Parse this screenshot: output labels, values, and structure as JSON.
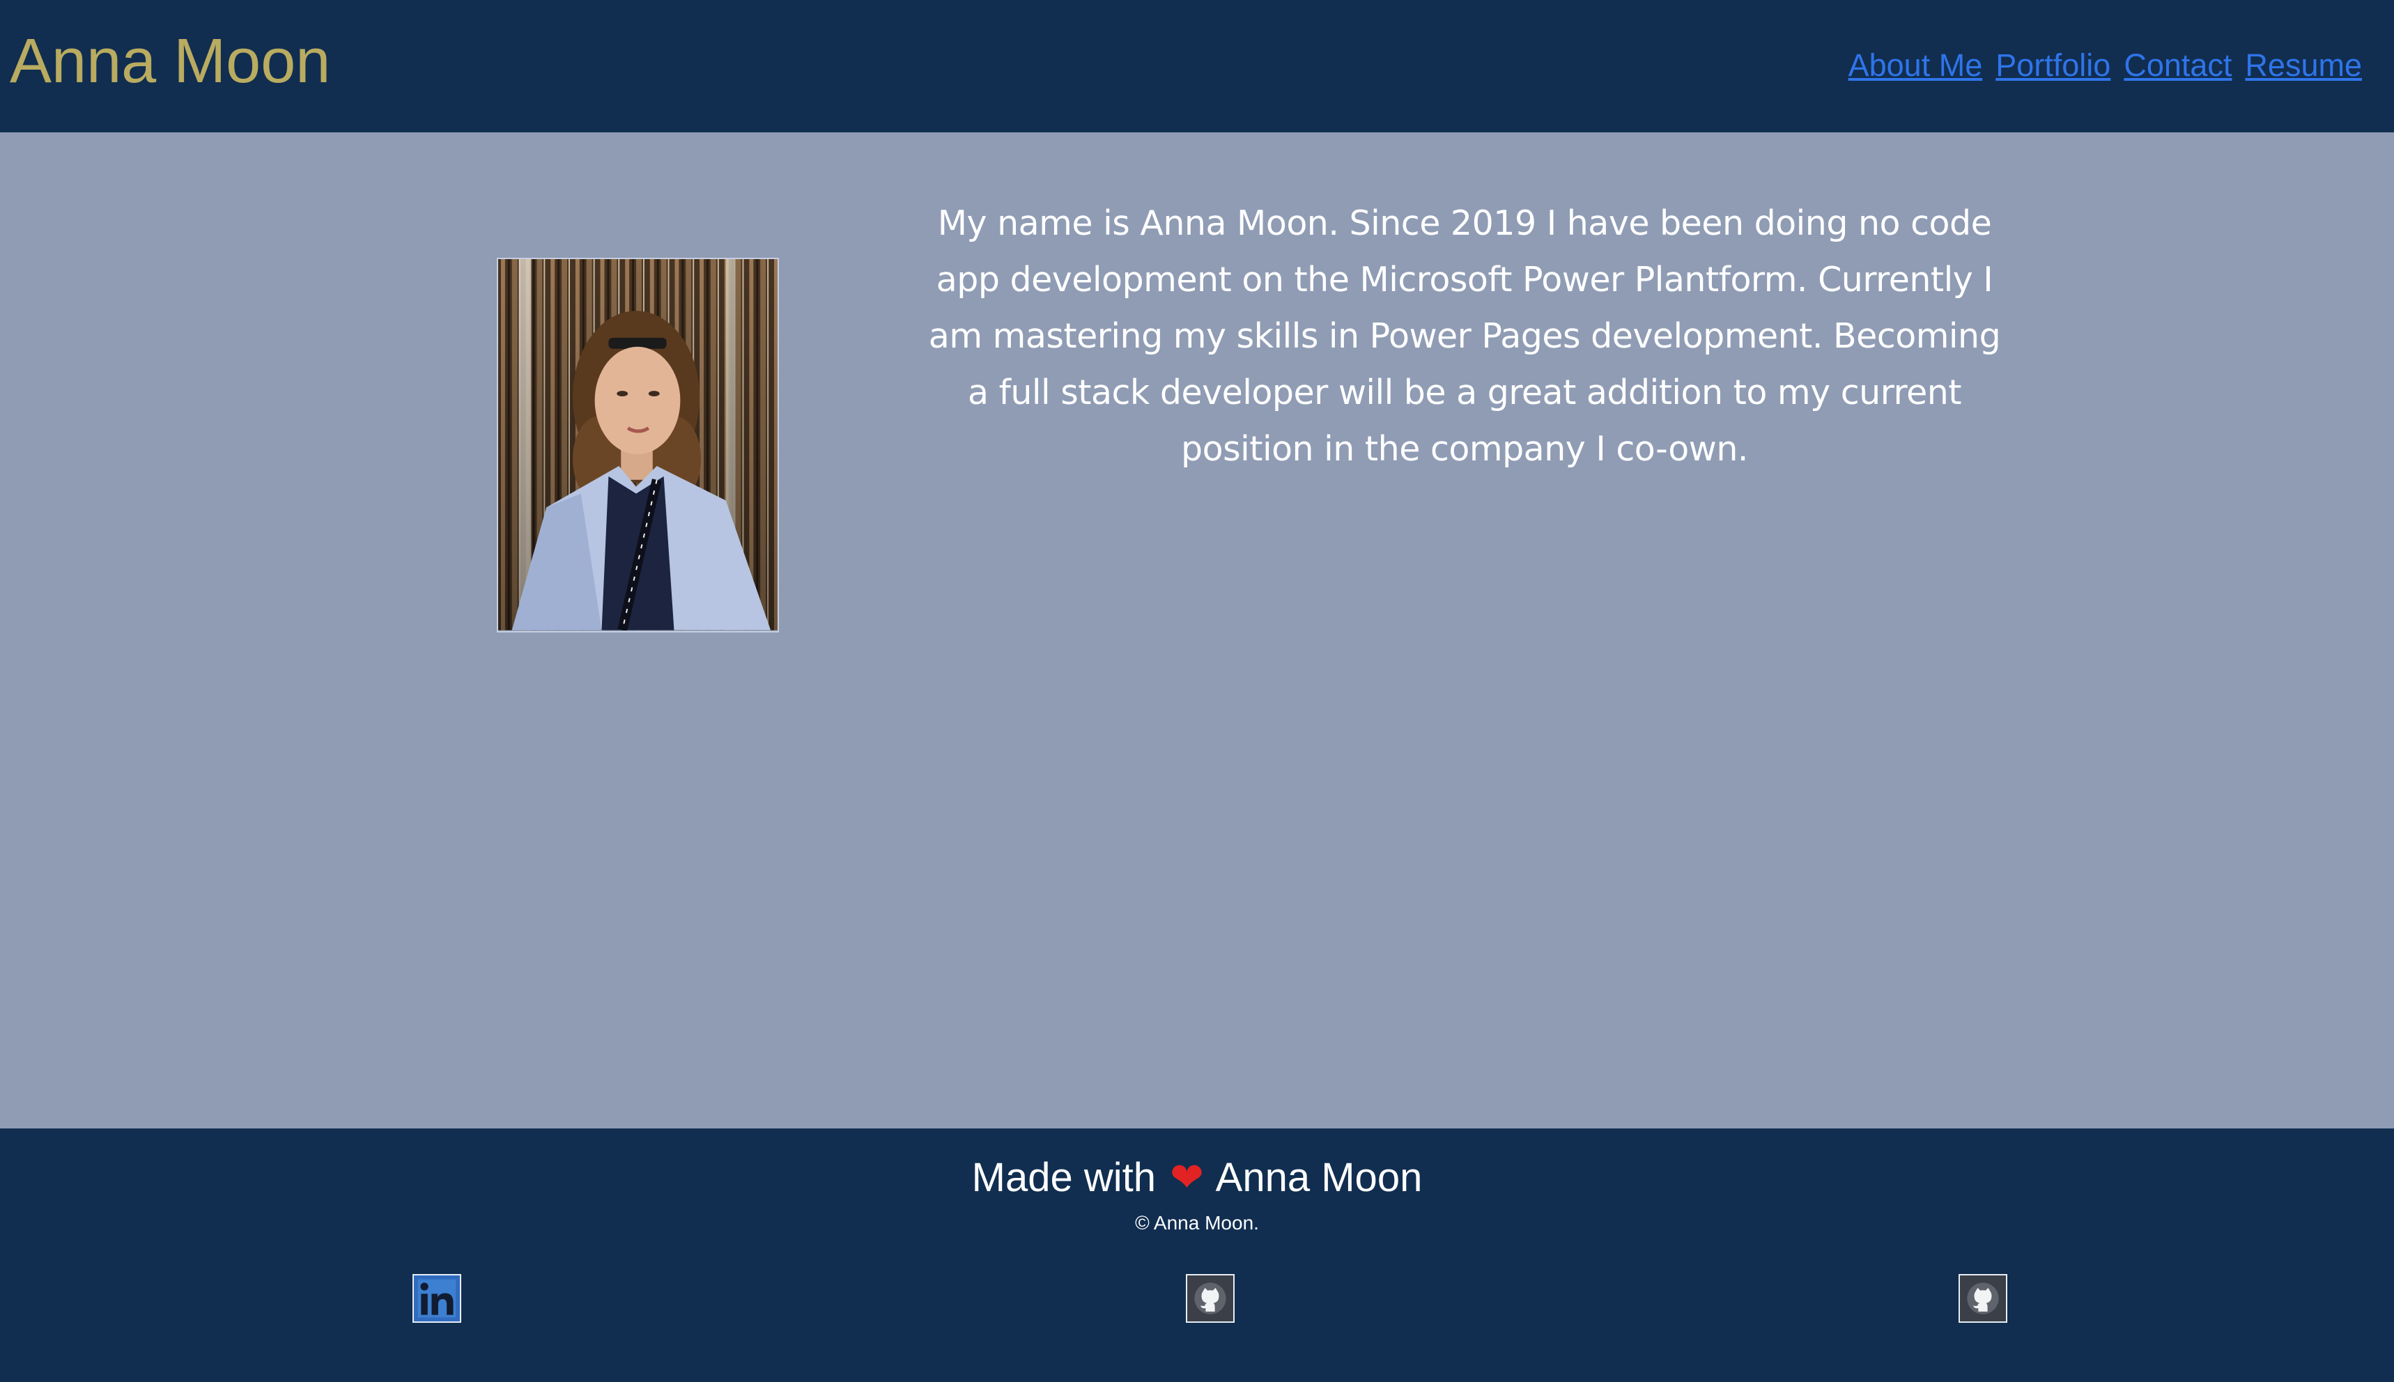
{
  "header": {
    "title": "Anna Moon",
    "nav": [
      {
        "label": "About Me"
      },
      {
        "label": "Portfolio"
      },
      {
        "label": "Contact"
      },
      {
        "label": "Resume"
      }
    ]
  },
  "main": {
    "portrait_icon": "portrait-photo",
    "bio": "My name is Anna Moon. Since 2019 I have been doing no code app development on the Microsoft Power Plantform. Currently I am mastering my skills in Power Pages development. Becoming a full stack developer will be a great addition to my current position in the company I co-own."
  },
  "footer": {
    "made_with_prefix": "Made with",
    "heart": "❤",
    "made_with_name": "Anna Moon",
    "copyright": "© Anna Moon.",
    "social": [
      {
        "icon": "linkedin-icon"
      },
      {
        "icon": "github-icon"
      },
      {
        "icon": "github-icon"
      }
    ]
  },
  "colors": {
    "header_bg": "#112e50",
    "page_bg": "#8f9cb4",
    "title": "#b9ab60",
    "link": "#2f74ea",
    "heart": "#e32323"
  }
}
